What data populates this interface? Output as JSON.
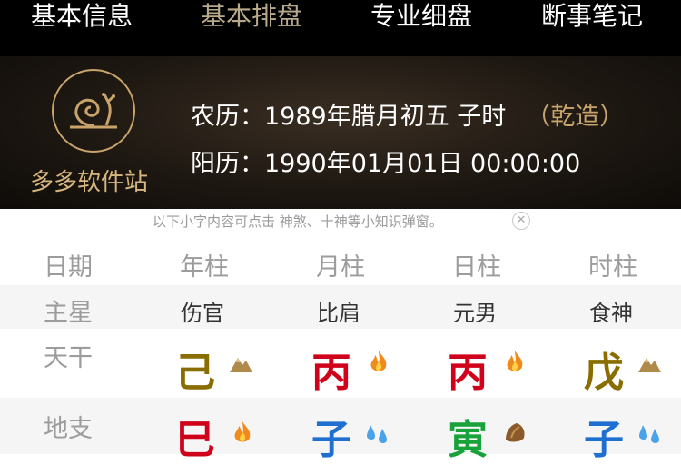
{
  "tabs": [
    "基本信息",
    "基本排盘",
    "专业细盘",
    "断事笔记"
  ],
  "active_tab": 1,
  "brand": {
    "name": "多多软件站",
    "icon": "snail-logo-icon"
  },
  "info": {
    "lunar_label": "农历：",
    "lunar_value": "1989年腊月初五 子时",
    "gender_tag": "（乾造）",
    "solar_label": "阳历：",
    "solar_value": "1990年01月01日 00:00:00"
  },
  "hint": {
    "text": "以下小字内容可点击 神煞、十神等小知识弹窗。",
    "close_icon": "close-circle-icon"
  },
  "table": {
    "header_label": "日期",
    "columns": [
      "年柱",
      "月柱",
      "日柱",
      "时柱"
    ],
    "main_star_label": "主星",
    "main_stars": [
      "伤官",
      "比肩",
      "元男",
      "食神"
    ],
    "tiangan_label": "天干",
    "tiangan": [
      {
        "char": "己",
        "color": "#8a6d00",
        "element": "earth-icon"
      },
      {
        "char": "丙",
        "color": "#d0021b",
        "element": "fire-icon"
      },
      {
        "char": "丙",
        "color": "#d0021b",
        "element": "fire-icon"
      },
      {
        "char": "戊",
        "color": "#8a6d00",
        "element": "earth-icon"
      }
    ],
    "dizhi_label": "地支",
    "dizhi": [
      {
        "char": "巳",
        "color": "#d0021b",
        "element": "fire-icon"
      },
      {
        "char": "子",
        "color": "#1f6fd1",
        "element": "water-icon"
      },
      {
        "char": "寅",
        "color": "#18a33a",
        "element": "wood-icon"
      },
      {
        "char": "子",
        "color": "#1f6fd1",
        "element": "water-icon"
      }
    ]
  },
  "colors": {
    "gold": "#c7a46c",
    "label_gray": "#9c9c9c"
  }
}
